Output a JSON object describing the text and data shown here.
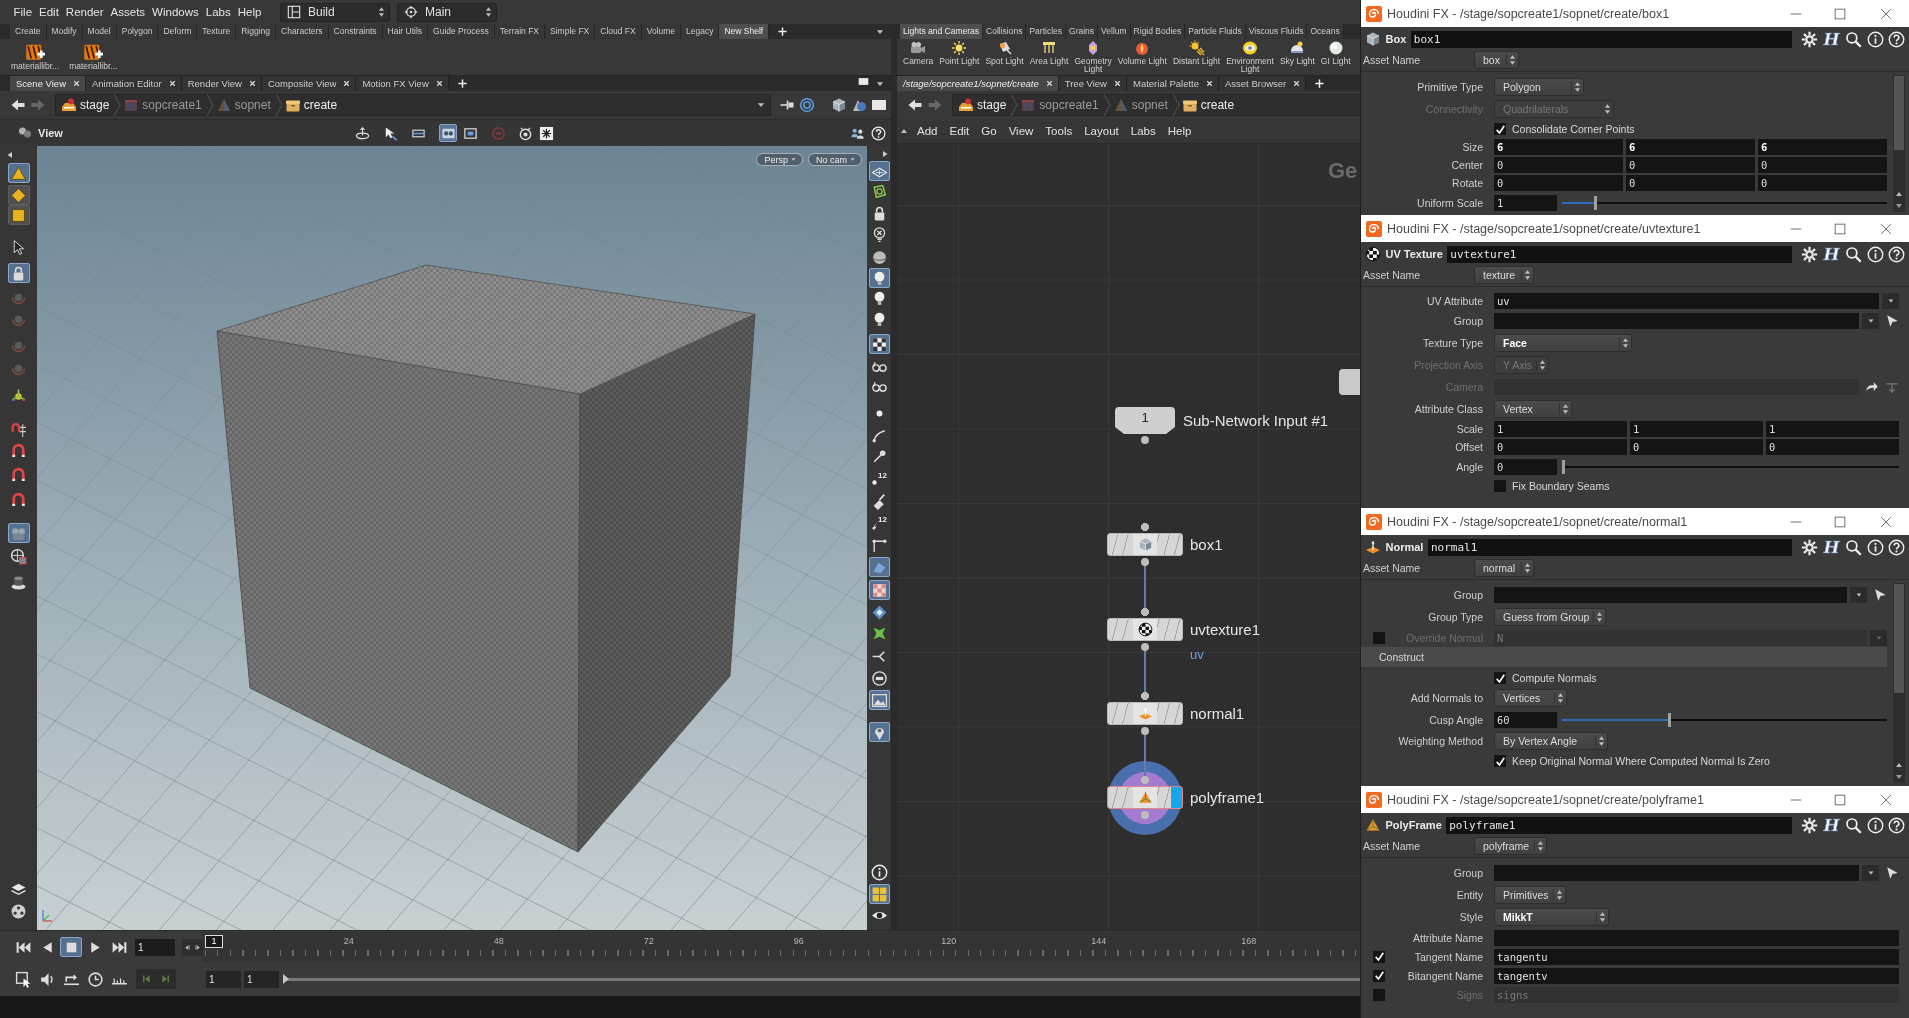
{
  "menu_bar": {
    "items": [
      "File",
      "Edit",
      "Render",
      "Assets",
      "Windows",
      "Labs",
      "Help"
    ],
    "desktops": [
      "Build",
      "Main"
    ]
  },
  "left_shelf": {
    "tabs": [
      {
        "label": "Create",
        "selected": false
      },
      {
        "label": "Modify",
        "selected": false
      },
      {
        "label": "Model",
        "selected": false
      },
      {
        "label": "Polygon",
        "selected": false
      },
      {
        "label": "Deform",
        "selected": false
      },
      {
        "label": "Texture",
        "selected": false
      },
      {
        "label": "Rigging",
        "selected": false
      },
      {
        "label": "Characters",
        "selected": false
      },
      {
        "label": "Constraints",
        "selected": false
      },
      {
        "label": "Hair Utils",
        "selected": false
      },
      {
        "label": "Guide Process",
        "selected": false
      },
      {
        "label": "Terrain FX",
        "selected": false
      },
      {
        "label": "Simple FX",
        "selected": false
      },
      {
        "label": "Cloud FX",
        "selected": false
      },
      {
        "label": "Volume",
        "selected": false
      },
      {
        "label": "Legacy",
        "selected": false
      },
      {
        "label": "New Shelf",
        "selected": true
      }
    ],
    "tools": [
      "materiallibr...",
      "materiallibr..."
    ]
  },
  "right_shelf": {
    "tabs": [
      {
        "label": "Lights and Cameras",
        "selected": true
      },
      {
        "label": "Collisions",
        "selected": false
      },
      {
        "label": "Particles",
        "selected": false
      },
      {
        "label": "Grains",
        "selected": false
      },
      {
        "label": "Vellum",
        "selected": false
      },
      {
        "label": "Rigid Bodies",
        "selected": false
      },
      {
        "label": "Particle Fluids",
        "selected": false
      },
      {
        "label": "Viscous Fluids",
        "selected": false
      },
      {
        "label": "Oceans",
        "selected": false
      }
    ],
    "tools": [
      "Camera",
      "Point Light",
      "Spot Light",
      "Area Light",
      "Geometry\nLight",
      "Volume Light",
      "Distant Light",
      "Environment\nLight",
      "Sky Light",
      "GI Light"
    ]
  },
  "scene_view": {
    "tabs": [
      {
        "label": "Scene View",
        "selected": true
      },
      {
        "label": "Animation Editor",
        "selected": false
      },
      {
        "label": "Render View",
        "selected": false
      },
      {
        "label": "Composite View",
        "selected": false
      },
      {
        "label": "Motion FX View",
        "selected": false
      }
    ],
    "path": [
      {
        "label": "stage",
        "dimmed": false
      },
      {
        "label": "sopcreate1",
        "dimmed": true
      },
      {
        "label": "sopnet",
        "dimmed": true
      },
      {
        "label": "create",
        "dimmed": false
      }
    ],
    "view_label": "View",
    "view_buttons": [
      {
        "on": false
      },
      {
        "on": false
      },
      {
        "on": false
      },
      {
        "on": true
      },
      {
        "on": false
      },
      {
        "on": false
      },
      {
        "on": false
      },
      {
        "on": false
      }
    ],
    "camera_menus": [
      "Persp",
      "No cam"
    ],
    "left_tools": [
      {
        "on": true
      },
      {
        "on": false
      },
      {
        "on": false
      },
      {
        "on": false
      },
      {
        "on": true
      },
      {
        "on": false
      },
      {
        "on": false
      },
      {
        "on": false
      },
      {
        "on": false
      },
      {
        "on": false
      },
      {
        "on": false
      },
      {
        "on": false
      },
      {
        "on": false
      },
      {
        "on": false
      },
      {
        "on": true
      },
      {
        "on": false
      },
      {
        "on": false
      },
      {
        "on": false
      },
      {
        "on": false
      }
    ],
    "right_tools": [
      {
        "on": true
      },
      {
        "on": false
      },
      {
        "on": false
      },
      {
        "on": false
      },
      {
        "on": false
      },
      {
        "on": true
      },
      {
        "on": false
      },
      {
        "on": false
      },
      {
        "on": true
      },
      {
        "on": false
      },
      {
        "on": false
      },
      {
        "on": false
      },
      {
        "on": false
      },
      {
        "on": false
      },
      {
        "on": false,
        "badge": "12"
      },
      {
        "on": false
      },
      {
        "on": false,
        "badge": "12"
      },
      {
        "on": false
      },
      {
        "on": true
      },
      {
        "on": true
      },
      {
        "on": false
      },
      {
        "on": false
      },
      {
        "on": false
      },
      {
        "on": false
      },
      {
        "on": true
      },
      {
        "on": true
      },
      {
        "on": false
      },
      {
        "on": true
      },
      {
        "on": false
      }
    ]
  },
  "network_view": {
    "tabs": [
      {
        "label": "/stage/sopcreate1/sopnet/create",
        "selected": true
      },
      {
        "label": "Tree View",
        "selected": false
      },
      {
        "label": "Material Palette",
        "selected": false
      },
      {
        "label": "Asset Browser",
        "selected": false
      }
    ],
    "path": [
      {
        "label": "stage",
        "dimmed": false
      },
      {
        "label": "sopcreate1",
        "dimmed": true
      },
      {
        "label": "sopnet",
        "dimmed": true
      },
      {
        "label": "create",
        "dimmed": false
      }
    ],
    "menu": [
      "Add",
      "Edit",
      "Go",
      "View",
      "Tools",
      "Layout",
      "Labs",
      "Help"
    ],
    "context_label": "Ge",
    "nodes": [
      {
        "kind": "input",
        "label": "Sub-Network Input #1",
        "number": "1",
        "selected": false,
        "display": false
      },
      {
        "kind": "sop",
        "label": "box1",
        "connected": false,
        "selected": false,
        "display": false
      },
      {
        "kind": "sop",
        "label": "uvtexture1",
        "attribute": "uv",
        "connected": true,
        "selected": false,
        "display": false
      },
      {
        "kind": "sop",
        "label": "normal1",
        "connected": true,
        "selected": false,
        "display": false
      },
      {
        "kind": "sop",
        "label": "polyframe1",
        "connected": true,
        "selected": true,
        "display": true
      }
    ]
  },
  "timeline": {
    "playback": [
      {
        "on": false
      },
      {
        "on": false
      },
      {
        "on": true
      },
      {
        "on": false
      },
      {
        "on": false
      }
    ],
    "frame": "1",
    "current_marker": "1",
    "ticks": [
      "24",
      "48",
      "72",
      "96",
      "120",
      "144",
      "168"
    ],
    "range_start": "1",
    "range_end": "1"
  },
  "parameter_windows": [
    {
      "title": "Houdini FX - /stage/sopcreate1/sopnet/create/box1",
      "type_label": "Box",
      "name": "box1",
      "hda_button": "H",
      "asset_label": "Asset Name",
      "asset_name": "box",
      "scrollable": true,
      "params": [
        {
          "kind": "menu",
          "label": "Primitive Type",
          "value": "Polygon",
          "changed": false,
          "disabled": false
        },
        {
          "kind": "menu",
          "label": "Connectivity",
          "value": "Quadrilaterals",
          "changed": false,
          "disabled": true
        },
        {
          "kind": "toggle",
          "label": "Consolidate Corner Points",
          "checked": true,
          "disabled": false
        },
        {
          "kind": "vector",
          "label": "Size",
          "values": [
            "6",
            "6",
            "6"
          ],
          "changed": true,
          "disabled": false
        },
        {
          "kind": "vector",
          "label": "Center",
          "values": [
            "0",
            "0",
            "0"
          ],
          "changed": false,
          "disabled": false
        },
        {
          "kind": "vector",
          "label": "Rotate",
          "values": [
            "0",
            "0",
            "0"
          ],
          "changed": false,
          "disabled": false
        },
        {
          "kind": "slider",
          "label": "Uniform Scale",
          "value": "1",
          "level": 0.1,
          "disabled": false
        }
      ]
    },
    {
      "title": "Houdini FX - /stage/sopcreate1/sopnet/create/uvtexture1",
      "type_label": "UV Texture",
      "name": "uvtexture1",
      "hda_button": "H",
      "asset_label": "Asset Name",
      "asset_name": "texture",
      "scrollable": false,
      "params": [
        {
          "kind": "string",
          "label": "UV Attribute",
          "value": "uv",
          "dropdown": true,
          "disabled": false
        },
        {
          "kind": "group",
          "label": "Group",
          "disabled": false
        },
        {
          "kind": "menu",
          "label": "Texture Type",
          "value": "Face",
          "changed": true,
          "disabled": false
        },
        {
          "kind": "menu",
          "label": "Projection Axis",
          "value": "Y Axis",
          "changed": false,
          "disabled": true
        },
        {
          "kind": "path",
          "label": "Camera",
          "disabled": true
        },
        {
          "kind": "menu",
          "label": "Attribute Class",
          "value": "Vertex",
          "changed": false,
          "disabled": false
        },
        {
          "kind": "vector",
          "label": "Scale",
          "values": [
            "1",
            "1",
            "1"
          ],
          "changed": false,
          "disabled": false
        },
        {
          "kind": "vector",
          "label": "Offset",
          "values": [
            "0",
            "0",
            "0"
          ],
          "changed": false,
          "disabled": false
        },
        {
          "kind": "slider",
          "label": "Angle",
          "value": "0",
          "level": 0,
          "disabled": false
        },
        {
          "kind": "toggle",
          "label": "Fix Boundary Seams",
          "checked": false,
          "disabled": false
        }
      ]
    },
    {
      "title": "Houdini FX - /stage/sopcreate1/sopnet/create/normal1",
      "type_label": "Normal",
      "name": "normal1",
      "hda_button": "H",
      "asset_label": "Asset Name",
      "asset_name": "normal",
      "scrollable": true,
      "params": [
        {
          "kind": "group",
          "label": "Group",
          "disabled": false
        },
        {
          "kind": "menu",
          "label": "Group Type",
          "value": "Guess from Group",
          "changed": false,
          "disabled": false
        },
        {
          "kind": "string",
          "label": "Override Normal",
          "value": "N",
          "dropdown": true,
          "use": false,
          "disabled": true
        },
        {
          "kind": "section",
          "label": "Construct"
        },
        {
          "kind": "toggle",
          "label": "Compute Normals",
          "checked": true,
          "disabled": false
        },
        {
          "kind": "menu",
          "label": "Add Normals to",
          "value": "Vertices",
          "changed": false,
          "disabled": false
        },
        {
          "kind": "slider",
          "label": "Cusp Angle",
          "value": "60",
          "level": 0.33,
          "disabled": false
        },
        {
          "kind": "menu",
          "label": "Weighting Method",
          "value": "By Vertex Angle",
          "changed": false,
          "disabled": false
        },
        {
          "kind": "toggle",
          "label": "Keep Original Normal Where Computed Normal Is Zero",
          "checked": true,
          "disabled": false
        }
      ]
    },
    {
      "title": "Houdini FX - /stage/sopcreate1/sopnet/create/polyframe1",
      "type_label": "PolyFrame",
      "name": "polyframe1",
      "hda_button": "H",
      "asset_label": "Asset Name",
      "asset_name": "polyframe",
      "scrollable": false,
      "params": [
        {
          "kind": "group",
          "label": "Group",
          "disabled": false
        },
        {
          "kind": "menu",
          "label": "Entity",
          "value": "Primitives",
          "changed": false,
          "disabled": false
        },
        {
          "kind": "menu",
          "label": "Style",
          "value": "MikkT",
          "changed": true,
          "disabled": false
        },
        {
          "kind": "string",
          "label": "Attribute Name",
          "dropdown": false,
          "disabled": false
        },
        {
          "kind": "string",
          "label": "Tangent Name",
          "value": "tangentu",
          "dropdown": false,
          "use": true,
          "disabled": false
        },
        {
          "kind": "string",
          "label": "Bitangent Name",
          "value": "tangentv",
          "dropdown": false,
          "use": true,
          "disabled": false
        },
        {
          "kind": "string",
          "label": "Signs",
          "value": "signs",
          "dropdown": false,
          "use": false,
          "disabled": true
        }
      ]
    }
  ]
}
